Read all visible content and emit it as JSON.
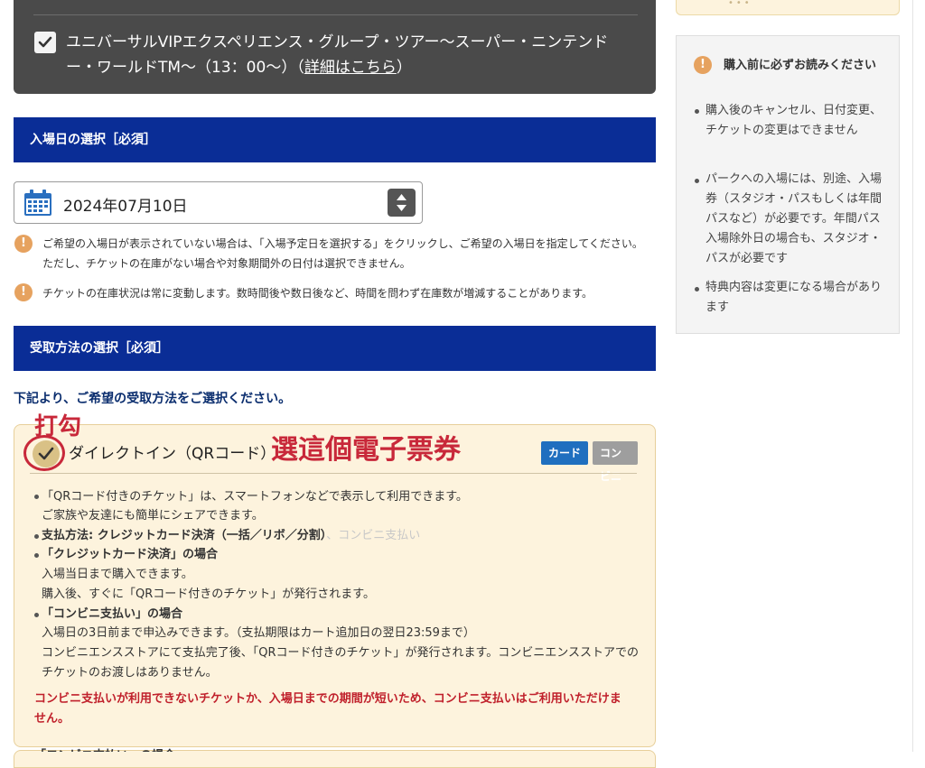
{
  "selected_tour": {
    "text": "ユニバーサルVIPエクスペリエンス・グループ・ツアー～スーパー・ニンテンドー・ワールドTM～（13：00～）（",
    "link": "詳細はこちら",
    "tail": "）"
  },
  "entry_date": {
    "header": "入場日の選択［必須］",
    "value": "2024年07月10日",
    "note1": "ご希望の入場日が表示されていない場合は、「入場予定日を選択する」をクリックし、ご希望の入場日を指定してください。ただし、チケットの在庫がない場合や対象期間外の日付は選択できません。",
    "note2": "チケットの在庫状況は常に変動します。数時間後や数日後など、時間を問わず在庫数が増減することがあります。"
  },
  "receive_method": {
    "header": "受取方法の選択［必須］",
    "instruction": "下記より、ご希望の受取方法をご選択ください。",
    "option": {
      "title": "ダイレクトイン（QRコード）",
      "badge_card": "カード",
      "badge_konbini": "コンビニ",
      "lines": {
        "l1": "「QRコード付きのチケット」は、スマートフォンなどで表示して利用できます。",
        "l2": "ご家族や友達にも簡単にシェアできます。",
        "l3a": "支払方法: クレジットカード決済（一括／リボ／分割）",
        "l3b": "、コンビニ支払い",
        "l4": "「クレジットカード決済」の場合",
        "l5": "入場当日まで購入できます。",
        "l6": "購入後、すぐに「QRコード付きのチケット」が発行されます。",
        "l7": "「コンビニ支払い」の場合",
        "l8": "入場日の3日前まで申込みできます。（支払期限はカート追加日の翌日23:59まで）",
        "l9": "コンビニエンスストアにて支払完了後、「QRコード付きのチケット」が発行されます。コンビニエンスストアでの",
        "l10": "チケットのお渡しはありません。"
      },
      "red_note": "コンビニ支払いが利用できないチケットか、入場日までの期間が短いため、コンビニ支払いはご利用いただけません。"
    },
    "next_partial": "「コンビニ支払い」の場合"
  },
  "annotations": {
    "check_label": "打勾",
    "pick_label": "選這個電子票券"
  },
  "sidebar": {
    "title": "購入前に必ずお読みください",
    "items": [
      "購入後のキャンセル、日付変更、チケットの変更はできません",
      "パークへの入場には、別途、入場券（スタジオ・パスもしくは年間パスなど）が必要です。年間パス入場除外日の場合も、スタジオ・パスが必要です",
      "特典内容は変更になる場合があります"
    ]
  },
  "colors": {
    "header_blue": "#0a2d96",
    "dark_card": "#4a4a4a",
    "option_bg": "#fdf3dd",
    "badge_card": "#1f6fbf",
    "badge_konbini": "#9e9e9e",
    "annotation_red": "#c8283a",
    "warn_orange": "#e6a25f"
  }
}
